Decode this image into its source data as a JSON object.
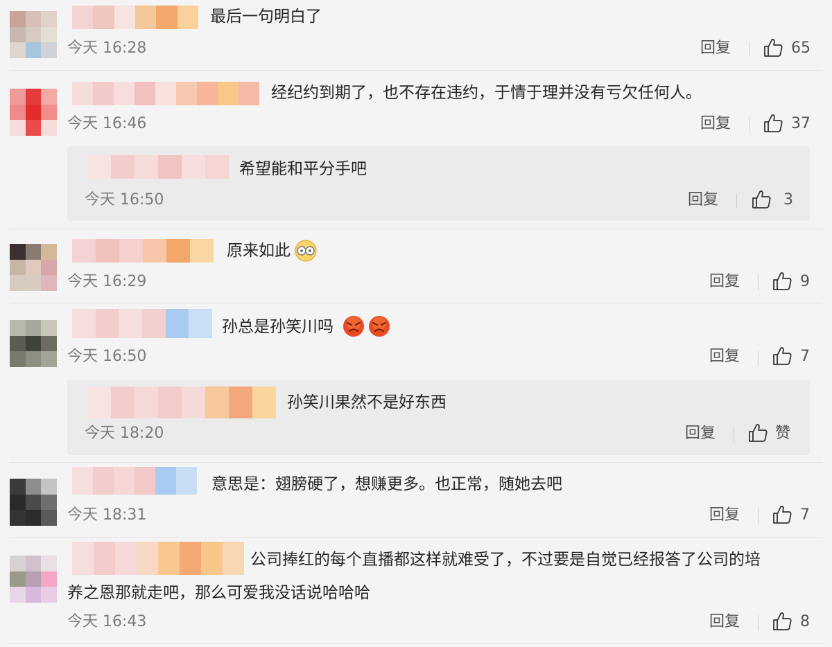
{
  "labels": {
    "reply": "回复",
    "like": "赞"
  },
  "comments": [
    {
      "text": "最后一句明白了",
      "time": "今天 16:28",
      "likes": "65"
    },
    {
      "text": "经纪约到期了，也不存在违约，于情于理并没有亏欠任何人。",
      "time": "今天 16:46",
      "likes": "37",
      "reply": {
        "text": "希望能和平分手吧",
        "time": "今天 16:50",
        "likes": "3"
      }
    },
    {
      "text": "原来如此",
      "time": "今天 16:29",
      "likes": "9",
      "emoji": "dazed-emoji"
    },
    {
      "text": "孙总是孙笑川吗",
      "time": "今天 16:50",
      "likes": "7",
      "emoji": "angry-emoji",
      "reply": {
        "text": "孙笑川果然不是好东西",
        "time": "今天 18:20",
        "likes": "赞"
      }
    },
    {
      "text": "意思是：翅膀硬了，想赚更多。也正常，随她去吧",
      "time": "今天 18:31",
      "likes": "7"
    },
    {
      "text_line1": "公司捧红的每个直播都这样就难受了，不过要是自觉已经报答了公司的培",
      "text_line2": "养之恩那就走吧，那么可爱我没话说哈哈哈",
      "time": "今天 16:43",
      "likes": "8"
    }
  ],
  "icons": {
    "like": "thumbs-up-icon"
  },
  "colors": {
    "background": "#f4f4f5",
    "reply_box": "#ebebec",
    "text": "#262626",
    "meta": "#7c7c7c"
  }
}
